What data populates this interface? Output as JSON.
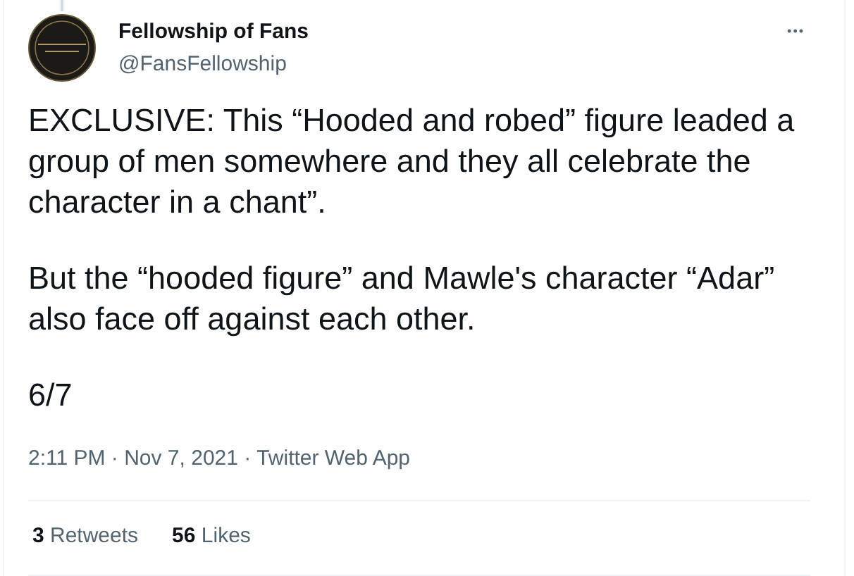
{
  "author": {
    "name": "Fellowship of Fans",
    "handle": "@FansFellowship"
  },
  "more_button": "•••",
  "paragraphs": [
    "EXCLUSIVE: This “Hooded and robed” figure leaded a group of men somewhere and they all celebrate the character in a chant”.",
    "But the “hooded figure” and Mawle's character “Adar” also face off against each other.",
    "6/7"
  ],
  "meta": [
    "2:11 PM",
    "·",
    "Nov 7, 2021",
    "·",
    "Twitter Web App"
  ],
  "stats": [
    {
      "count": "3",
      "label": "Retweets"
    },
    {
      "count": "56",
      "label": "Likes"
    }
  ]
}
